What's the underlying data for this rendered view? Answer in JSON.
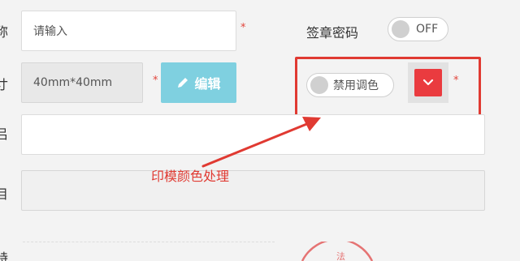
{
  "labels": {
    "row1": "称",
    "row2": "寸",
    "row3": "吕",
    "row4": "目",
    "row5": "特"
  },
  "name_input": {
    "placeholder": "请输入"
  },
  "size_input": {
    "value": "40mm*40mm"
  },
  "edit_button": {
    "label": "编辑",
    "icon": "pencil-icon"
  },
  "seal_password": {
    "label": "签章密码",
    "state": "OFF"
  },
  "disable_color": {
    "label": "禁用调色"
  },
  "color_picker": {
    "icon": "chevron-down-icon",
    "color": "#ea3b3f"
  },
  "required_mark": "*",
  "annotation": {
    "text": "印模颜色处理",
    "color": "#e03a32"
  },
  "stamp_glyph": "法"
}
